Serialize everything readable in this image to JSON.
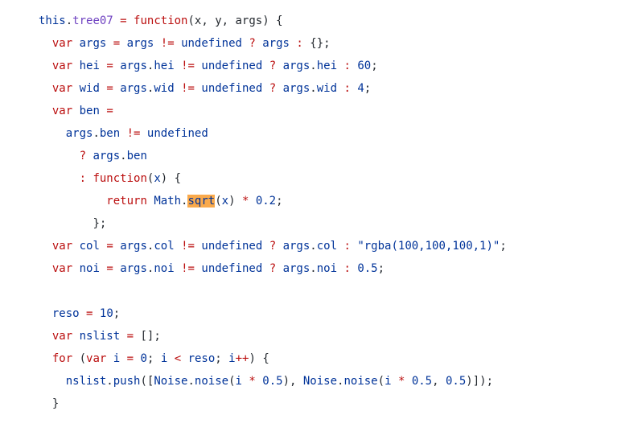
{
  "code": {
    "kw_this": "this",
    "fn_name": "tree07",
    "kw_function": "function",
    "kw_var": "var",
    "kw_return": "return",
    "kw_for": "for",
    "kw_undefined": "undefined",
    "params": "(x, y, args)",
    "id_args": "args",
    "id_hei": "hei",
    "id_wid": "wid",
    "id_ben": "ben",
    "id_col": "col",
    "id_noi": "noi",
    "id_reso": "reso",
    "id_nslist": "nslist",
    "id_i": "i",
    "id_Math": "Math",
    "id_sqrt": "sqrt",
    "id_x": "x",
    "id_Noise": "Noise",
    "id_noise": "noise",
    "id_push": "push",
    "num_60": "60",
    "num_4": "4",
    "num_0_2": "0.2",
    "num_0_5": "0.5",
    "num_10": "10",
    "num_0": "0",
    "str_rgba": "\"rgba(100,100,100,1)\"",
    "empty_obj": "{}",
    "empty_arr": "[]",
    "op_eq": "=",
    "op_neq": "!=",
    "op_q": "?",
    "op_colon": ":",
    "op_lt": "<",
    "op_inc": "++",
    "op_mul": "*",
    "dot": ".",
    "semi": ";",
    "comma": ",",
    "lbrace": "{",
    "rbrace": "}",
    "lparen": "(",
    "rparen": ")",
    "lbrack": "[",
    "rbrack": "]"
  }
}
